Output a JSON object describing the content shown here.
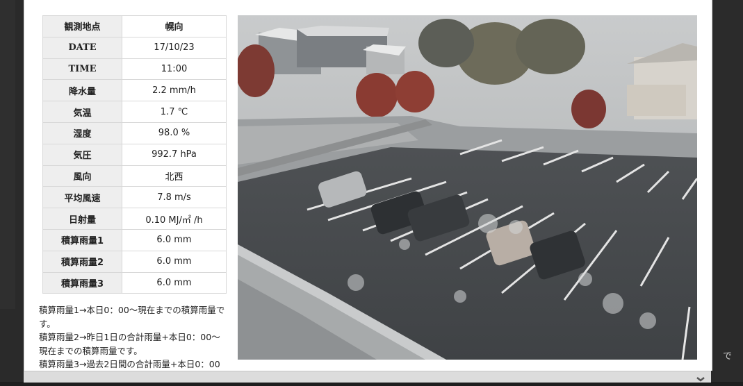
{
  "table": {
    "rows": [
      {
        "label": "観測地点",
        "value": "幌向"
      },
      {
        "label": "DATE",
        "value": "17/10/23"
      },
      {
        "label": "TIME",
        "value": "11:00"
      },
      {
        "label": "降水量",
        "value": "2.2 mm/h"
      },
      {
        "label": "気温",
        "value": "1.7 ℃"
      },
      {
        "label": "湿度",
        "value": "98.0 %"
      },
      {
        "label": "気圧",
        "value": "992.7 hPa"
      },
      {
        "label": "風向",
        "value": "北西"
      },
      {
        "label": "平均風速",
        "value": "7.8 m/s"
      },
      {
        "label": "日射量",
        "value": "0.10 MJ/㎡ /h"
      },
      {
        "label": "積算雨量1",
        "value": "6.0 mm"
      },
      {
        "label": "積算雨量2",
        "value": "6.0 mm"
      },
      {
        "label": "積算雨量3",
        "value": "6.0 mm"
      }
    ]
  },
  "notes": [
    "積算雨量1→本日0：00〜現在までの積算雨量です。",
    "積算雨量2→昨日1日の合計雨量+本日0：00〜現在までの積算雨量です。",
    "積算雨量3→過去2日間の合計雨量+本日0：00"
  ],
  "background_side_text": "で",
  "icons": {
    "close": "close-icon"
  },
  "colors": {
    "label_bg": "#eeeeee",
    "border": "#d8d8d8",
    "footer": "#dcdcdc"
  }
}
